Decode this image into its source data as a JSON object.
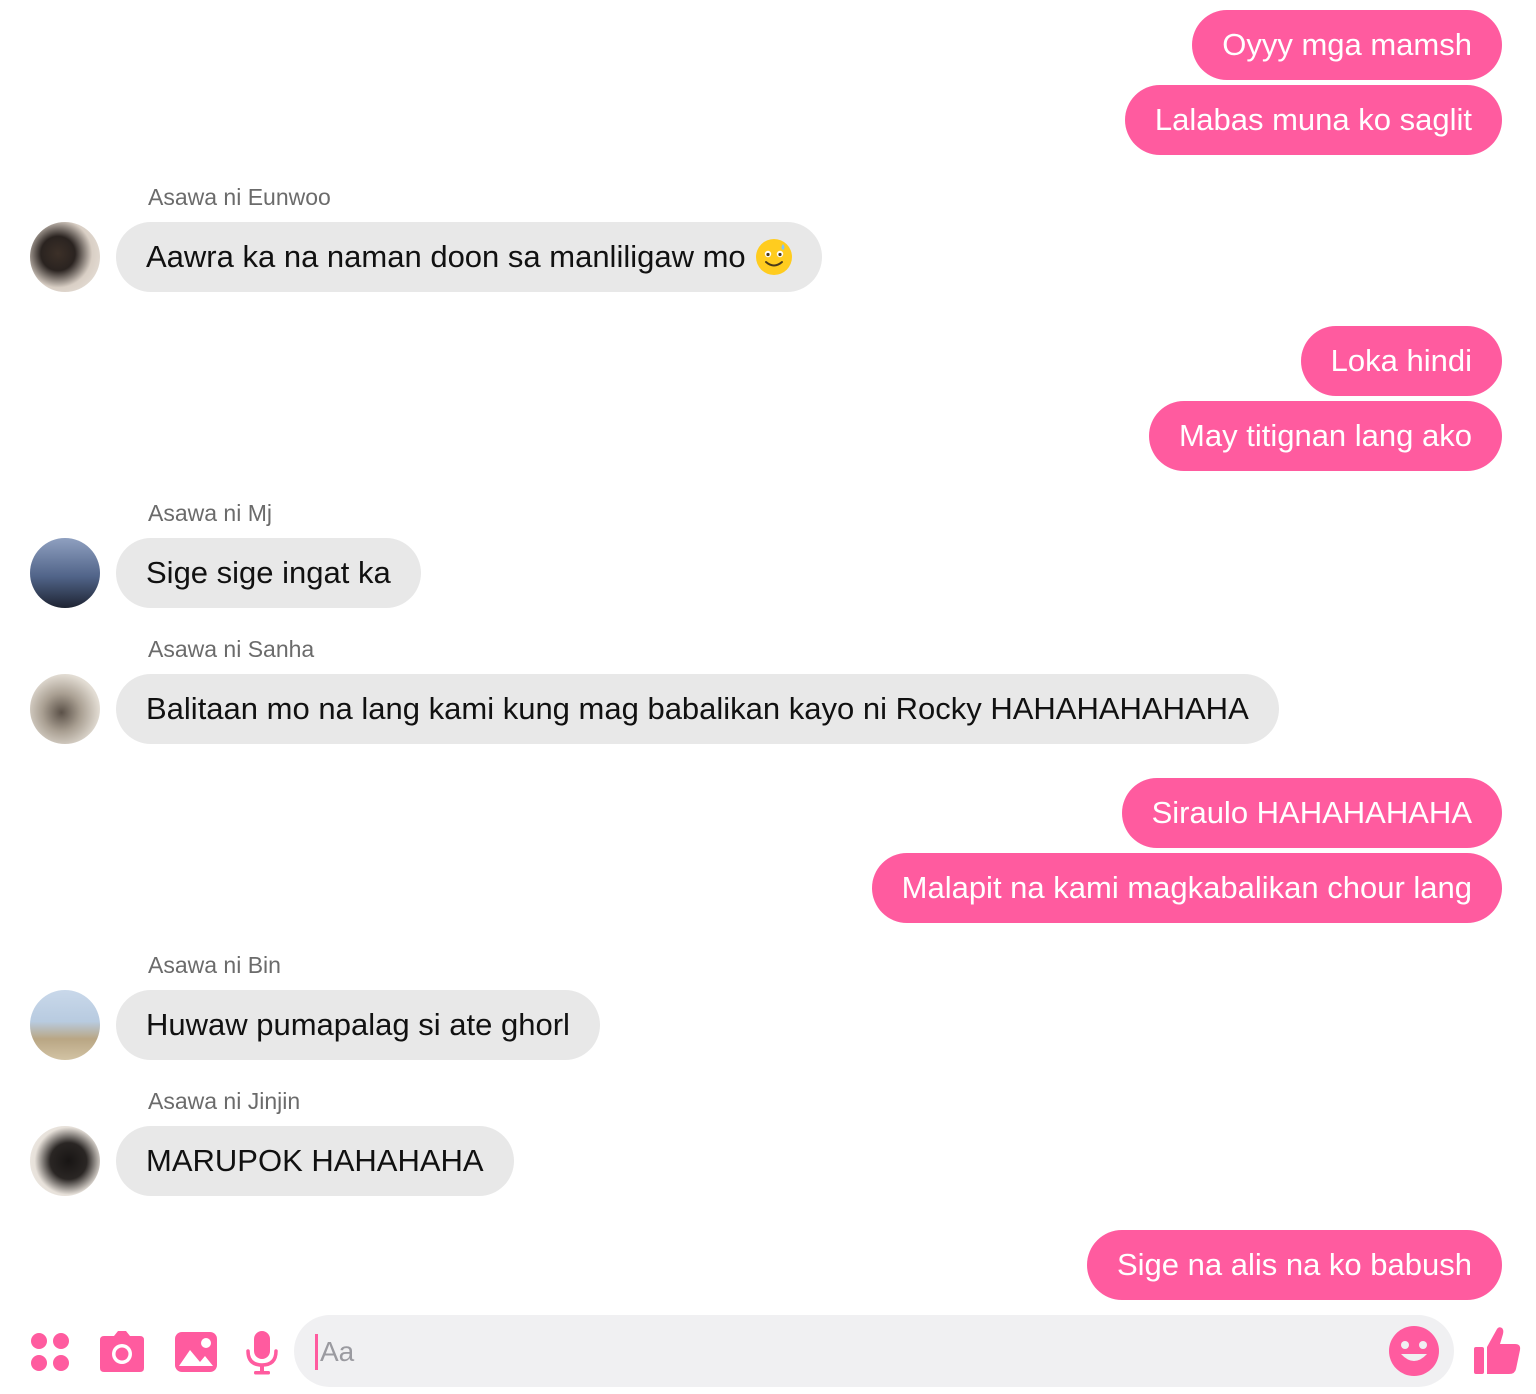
{
  "messages": [
    {
      "type": "out",
      "text": "Oyyy mga mamsh"
    },
    {
      "type": "out",
      "text": "Lalabas muna ko saglit"
    },
    {
      "type": "in",
      "sender": "Asawa ni Eunwoo",
      "text": "Aawra ka na naman doon sa manliligaw mo",
      "emoji": "smiling-sweat-emoji"
    },
    {
      "type": "out",
      "text": "Loka hindi"
    },
    {
      "type": "out",
      "text": "May titignan lang ako"
    },
    {
      "type": "in",
      "sender": "Asawa ni Mj",
      "text": "Sige sige ingat ka"
    },
    {
      "type": "in",
      "sender": "Asawa ni Sanha",
      "text": "Balitaan mo na lang kami kung mag babalikan kayo ni Rocky HAHAHAHAHAHA"
    },
    {
      "type": "out",
      "text": "Siraulo HAHAHAHAHA"
    },
    {
      "type": "out",
      "text": "Malapit na kami magkabalikan chour lang"
    },
    {
      "type": "in",
      "sender": "Asawa ni Bin",
      "text": "Huwaw pumapalag si ate ghorl"
    },
    {
      "type": "in",
      "sender": "Asawa ni Jinjin",
      "text": "MARUPOK HAHAHAHA"
    },
    {
      "type": "out",
      "text": "Sige na alis na ko babush"
    }
  ],
  "composer": {
    "placeholder": "Aa",
    "tools": [
      "apps-icon",
      "camera-icon",
      "gallery-icon",
      "microphone-icon"
    ],
    "emoji_icon": "smiley-icon",
    "send_icon": "thumbs-up-icon"
  },
  "colors": {
    "accent": "#ff5b9f",
    "incoming_bubble": "#e8e8e8",
    "sender_text": "#6b6b6b"
  }
}
